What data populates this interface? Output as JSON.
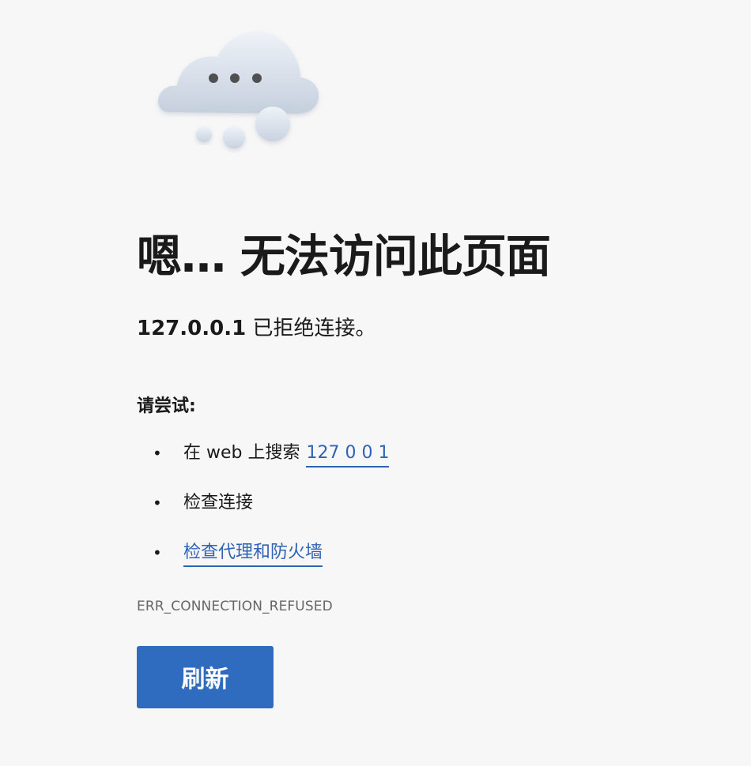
{
  "illustration": {
    "icon": "cloud-with-dots-icon"
  },
  "title": "嗯… 无法访问此页面",
  "subtitle": {
    "host": "127.0.0.1",
    "message": " 已拒绝连接。"
  },
  "try": {
    "heading": "请尝试:"
  },
  "suggestions": [
    {
      "bullet": "•",
      "prefix": "在 web 上搜索",
      "link": "127 0 0 1"
    },
    {
      "bullet": "•",
      "text": "检查连接"
    },
    {
      "bullet": "•",
      "link": "检查代理和防火墙"
    }
  ],
  "error_code": "ERR_CONNECTION_REFUSED",
  "actions": {
    "refresh_label": "刷新"
  },
  "colors": {
    "background": "#f7f7f7",
    "text": "#1a1a1a",
    "link": "#2f63b5",
    "button": "#2f6bbf",
    "button_text": "#ffffff",
    "error_code": "#666666"
  }
}
